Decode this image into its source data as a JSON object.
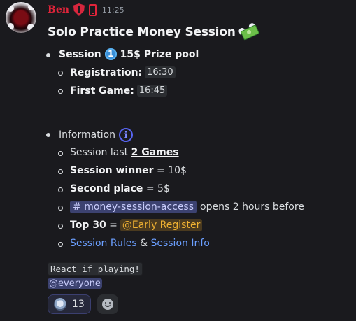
{
  "author": {
    "username": "Ben",
    "timestamp": "11:25",
    "badges": [
      "shield-icon",
      "mobile-phone-icon"
    ]
  },
  "title": {
    "text": "Solo Practice Money Session",
    "emoji": "money-with-wings-icon"
  },
  "session": {
    "label": "Session",
    "number_badge": "1",
    "prize": "15$ Prize pool",
    "registration_label": "Registration:",
    "registration_time": "16:30",
    "first_game_label": "First Game:",
    "first_game_time": "16:45"
  },
  "information": {
    "label": "Information",
    "icon": "info-icon",
    "session_last_prefix": "Session last",
    "session_last_value": "2 Games",
    "winner_label": "Session winner",
    "winner_value": "= 10$",
    "second_label": "Second place",
    "second_value": "= 5$",
    "channel_name": "money-session-access",
    "channel_suffix": "opens 2 hours before",
    "top30_label": "Top 30",
    "top30_eq": "=",
    "top30_role": "@Early Register",
    "rules_link": "Session Rules",
    "amp": "&",
    "info_link": "Session Info"
  },
  "footer": {
    "code_text": "React if playing!",
    "mention": "@everyone"
  },
  "reaction": {
    "emoji": "custom-emoji-icon",
    "count": "13"
  },
  "colors": {
    "username": "#e0243a",
    "background": "#1a1a1e",
    "link": "#6b9fff",
    "role_mention": "#f0b232",
    "channel_mention": "#c9cdfb"
  }
}
